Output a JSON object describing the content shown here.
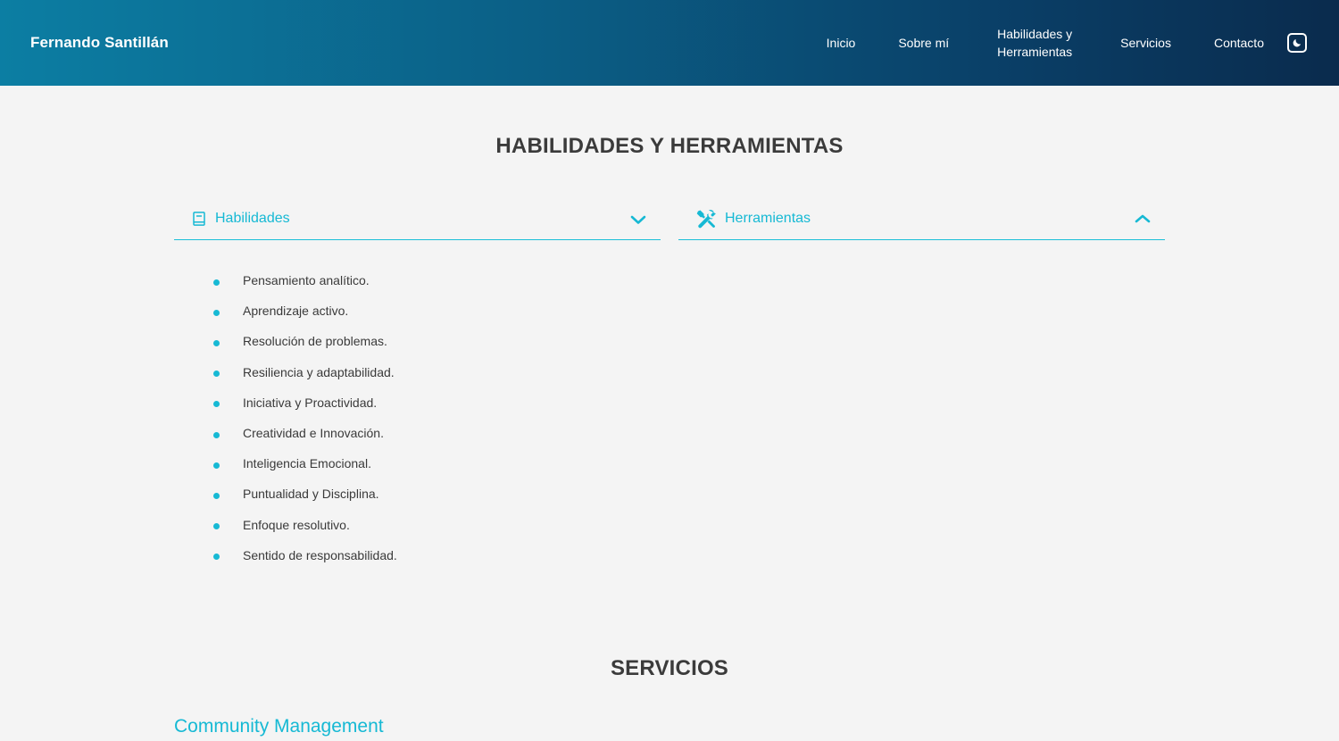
{
  "header": {
    "brand": "Fernando Santillán",
    "nav": [
      {
        "label": "Inicio"
      },
      {
        "label": "Sobre mí"
      },
      {
        "label": "Habilidades y Herramientas"
      },
      {
        "label": "Servicios"
      },
      {
        "label": "Contacto"
      }
    ],
    "theme_icon": "moon-icon"
  },
  "skills_section": {
    "title": "HABILIDADES Y HERRAMIENTAS",
    "habilidades": {
      "title": "Habilidades",
      "icon": "book-icon",
      "state_icon": "chevron-down-icon",
      "items": [
        "Pensamiento analítico.",
        "Aprendizaje activo.",
        "Resolución de problemas.",
        "Resiliencia y adaptabilidad.",
        "Iniciativa y Proactividad.",
        "Creatividad e Innovación.",
        "Inteligencia Emocional.",
        "Puntualidad y Disciplina.",
        "Enfoque resolutivo.",
        "Sentido de responsabilidad."
      ]
    },
    "herramientas": {
      "title": "Herramientas",
      "icon": "tools-icon",
      "state_icon": "chevron-up-icon"
    }
  },
  "services_section": {
    "title": "SERVICIOS",
    "first_service": "Community Management"
  },
  "colors": {
    "accent": "#16b9d4",
    "header_start": "#0c7ea3",
    "header_end": "#0a2b4d",
    "background": "#f4f4f4",
    "heading": "#3b3b3b"
  }
}
